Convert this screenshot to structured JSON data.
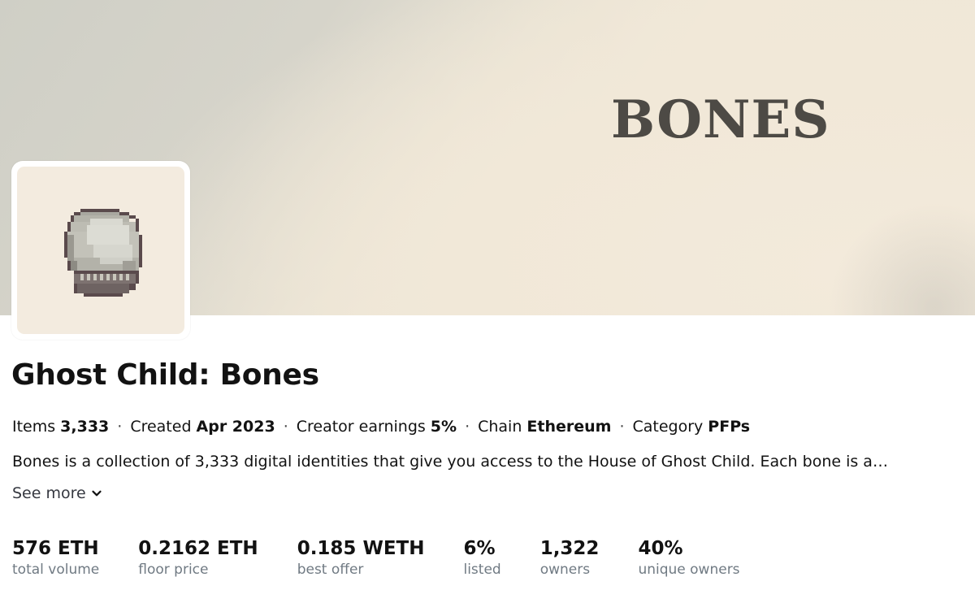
{
  "banner": {
    "logo_text": "BONES"
  },
  "avatar": {
    "icon": "pixel-skull-icon"
  },
  "collection": {
    "title": "Ghost Child: Bones",
    "meta": {
      "items_label": "Items",
      "items_value": "3,333",
      "created_label": "Created",
      "created_value": "Apr 2023",
      "earnings_label": "Creator earnings",
      "earnings_value": "5%",
      "chain_label": "Chain",
      "chain_value": "Ethereum",
      "category_label": "Category",
      "category_value": "PFPs",
      "separator": "·"
    },
    "description": "Bones is a collection of 3,333 digital identities that give you access to the House of Ghost Child. Each bone is a…",
    "see_more_label": "See more"
  },
  "stats": [
    {
      "value": "576 ETH",
      "label": "total volume"
    },
    {
      "value": "0.2162 ETH",
      "label": "floor price"
    },
    {
      "value": "0.185 WETH",
      "label": "best offer"
    },
    {
      "value": "6%",
      "label": "listed"
    },
    {
      "value": "1,322",
      "label": "owners"
    },
    {
      "value": "40%",
      "label": "unique owners"
    }
  ]
}
